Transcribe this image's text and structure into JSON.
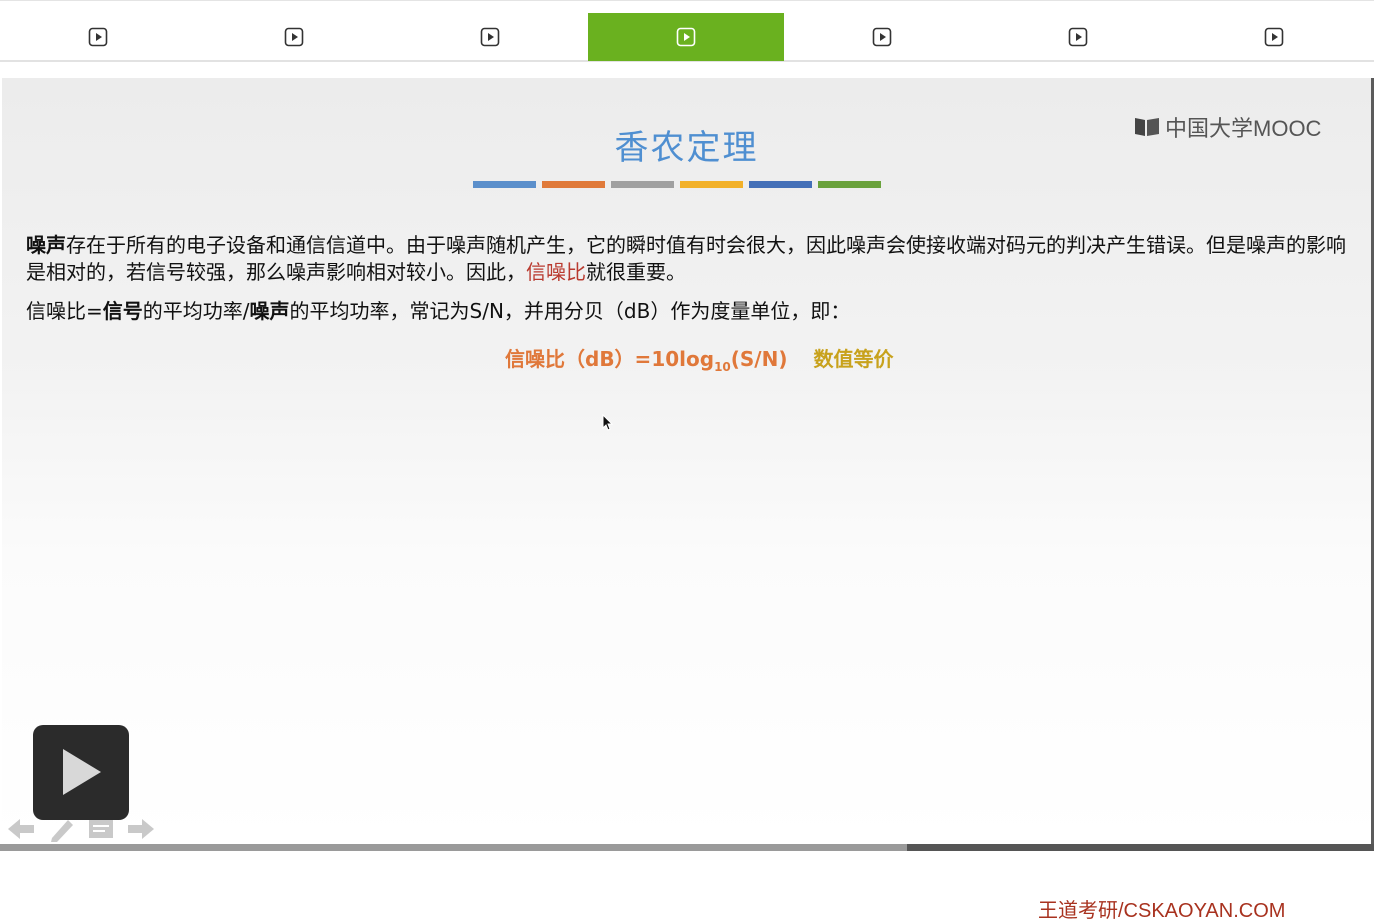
{
  "tabs": [
    {
      "icon": "play-box-icon",
      "active": false
    },
    {
      "icon": "play-box-icon",
      "active": false
    },
    {
      "icon": "play-box-icon",
      "active": false
    },
    {
      "icon": "play-box-icon",
      "active": true
    },
    {
      "icon": "play-box-icon",
      "active": false
    },
    {
      "icon": "play-box-icon",
      "active": false
    },
    {
      "icon": "play-box-icon",
      "active": false
    }
  ],
  "slide": {
    "title": "香农定理",
    "logo_text": "中国大学MOOC",
    "color_bars": [
      "#5b8fcb",
      "#e07a3a",
      "#a0a0a0",
      "#f2b12a",
      "#4470b8",
      "#6aa23c"
    ],
    "para1": {
      "bold_lead": "噪声",
      "text": "存在于所有的电子设备和通信信道中。由于噪声随机产生，它的瞬时值有时会很大，因此噪声会使接收端对码元的判决产生错误。但是噪声的影响是相对的，若信号较强，那么噪声影响相对较小。因此，",
      "highlight": "信噪比",
      "tail": "就很重要。"
    },
    "para2": {
      "a": "信噪比=",
      "b": "信号",
      "c": "的平均功率/",
      "d": "噪声",
      "e": "的平均功率，常记为S/N，并用分贝（dB）作为度量单位，即："
    },
    "formula": {
      "left": "信噪比（dB）=10log",
      "sub": "10",
      "right": "(S/N)",
      "note": "数值等价"
    },
    "footer": "王道考研/CSKAOYAN.COM"
  },
  "player": {
    "progress_fraction": 0.638,
    "buffered_fraction": 0.66,
    "icons": [
      "back-arrow-icon",
      "pen-icon",
      "notes-icon",
      "forward-arrow-icon"
    ]
  },
  "colors": {
    "accent": "#6ab11f",
    "title": "#4f8fd1",
    "highlight": "#b93a2f",
    "formula": "#e0783a",
    "formula_note": "#c8a21c",
    "footer": "#a8321f"
  }
}
